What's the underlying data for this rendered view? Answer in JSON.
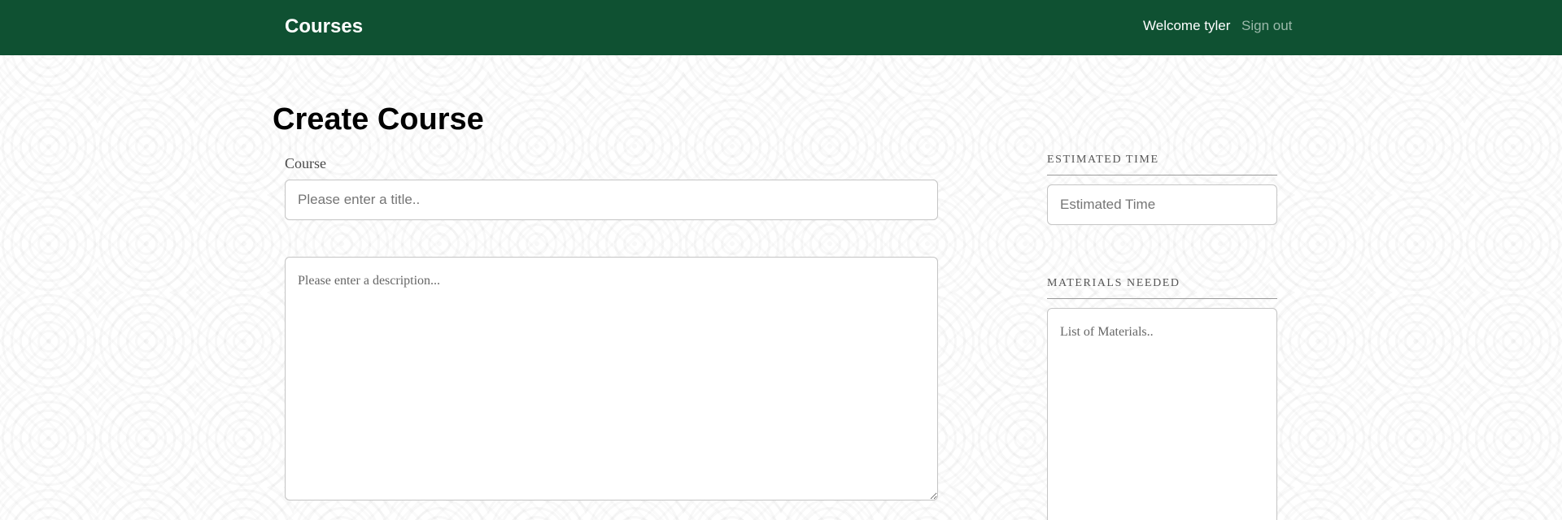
{
  "header": {
    "brand": "Courses",
    "welcome": "Welcome tyler",
    "sign_out": "Sign out",
    "background_color": "#0f5132"
  },
  "main": {
    "page_title": "Create Course",
    "course_label": "Course",
    "title_placeholder": "Please enter a title..",
    "title_value": "",
    "description_placeholder": "Please enter a description...",
    "description_value": ""
  },
  "sidebar": {
    "estimated_time_heading": "ESTIMATED TIME",
    "estimated_time_placeholder": "Estimated Time",
    "estimated_time_value": "",
    "materials_heading": "MATERIALS NEEDED",
    "materials_placeholder": "List of Materials..",
    "materials_value": ""
  }
}
